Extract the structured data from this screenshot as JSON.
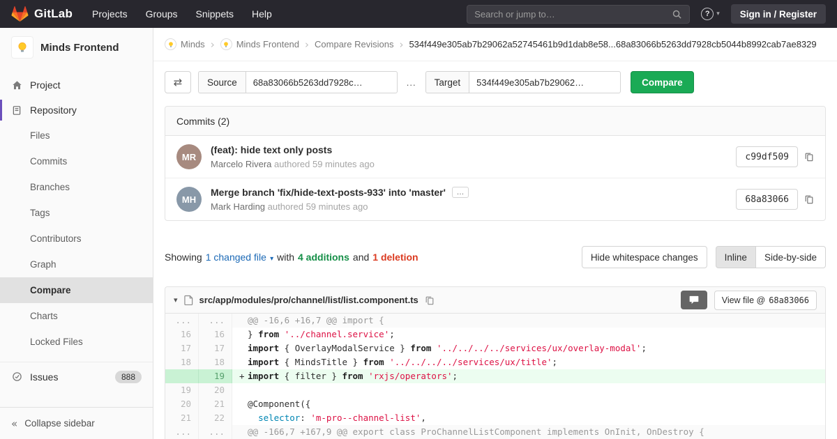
{
  "navbar": {
    "brand": "GitLab",
    "menu": [
      "Projects",
      "Groups",
      "Snippets",
      "Help"
    ],
    "search": {
      "placeholder": "Search or jump to…"
    },
    "help_icon": "?",
    "sign_in_label": "Sign in / Register"
  },
  "sidebar": {
    "project": {
      "name": "Minds Frontend"
    },
    "items": [
      {
        "label": "Project"
      },
      {
        "label": "Repository"
      }
    ],
    "repo_subitems": [
      {
        "label": "Files"
      },
      {
        "label": "Commits"
      },
      {
        "label": "Branches"
      },
      {
        "label": "Tags"
      },
      {
        "label": "Contributors"
      },
      {
        "label": "Graph"
      },
      {
        "label": "Compare",
        "active": true
      },
      {
        "label": "Charts"
      },
      {
        "label": "Locked Files"
      }
    ],
    "issues": {
      "label": "Issues",
      "badge": "888"
    },
    "collapse_label": "Collapse sidebar"
  },
  "breadcrumb": {
    "links": [
      {
        "label": "Minds",
        "avatar": true
      },
      {
        "label": "Minds Frontend",
        "avatar": true
      },
      {
        "label": "Compare Revisions",
        "avatar": false
      }
    ],
    "current": "534f449e305ab7b29062a52745461b9d1dab8e58...68a83066b5263dd7928cb5044b8992cab7ae8329"
  },
  "compare_form": {
    "source_label": "Source",
    "source_value": "68a83066b5263dd7928c…",
    "separator": "...",
    "target_label": "Target",
    "target_value": "534f449e305ab7b29062…",
    "compare_button": "Compare",
    "compare_color": "#1aaa55"
  },
  "commits": {
    "title": "Commits (2)",
    "items": [
      {
        "title": "(feat): hide text only posts",
        "author": "Marcelo Rivera",
        "meta": "authored 59 minutes ago",
        "sha": "c99df509",
        "avatar_initials": "MR",
        "avatar_color": "#a78a7f",
        "expandable": false,
        "expander": "…"
      },
      {
        "title": "Merge branch 'fix/hide-text-posts-933' into 'master'",
        "author": "Mark Harding",
        "meta": "authored 59 minutes ago",
        "sha": "68a83066",
        "avatar_initials": "MH",
        "avatar_color": "#8898a8",
        "expandable": true,
        "expander": "…"
      }
    ]
  },
  "summary": {
    "showing": "Showing",
    "changed_file": "1 changed file",
    "with_text": "with",
    "additions": "4 additions",
    "and_text": "and",
    "deletions": "1 deletion",
    "additions_color": "#168f48",
    "deletions_color": "#db3b21",
    "hide_whitespace": "Hide whitespace changes",
    "inline": "Inline",
    "side_by_side": "Side-by-side"
  },
  "diff": {
    "file_path": "src/app/modules/pro/channel/list/list.component.ts",
    "view_file_label": "View file @",
    "view_file_sha": "68a83066",
    "lines": [
      {
        "type": "hunk",
        "old": "...",
        "new": "...",
        "marker": "",
        "segments": [
          {
            "text": "@@ -16,6 +16,7 @@ import {",
            "cls": "hunk"
          }
        ]
      },
      {
        "type": "context",
        "old": "16",
        "new": "16",
        "marker": "",
        "segments": [
          {
            "text": "} ",
            "cls": "p"
          },
          {
            "text": "from",
            "cls": "k"
          },
          {
            "text": " ",
            "cls": "p"
          },
          {
            "text": "'../channel.service'",
            "cls": "s"
          },
          {
            "text": ";",
            "cls": "p"
          }
        ]
      },
      {
        "type": "context",
        "old": "17",
        "new": "17",
        "marker": "",
        "segments": [
          {
            "text": "import",
            "cls": "k"
          },
          {
            "text": " { OverlayModalService } ",
            "cls": "p"
          },
          {
            "text": "from",
            "cls": "k"
          },
          {
            "text": " ",
            "cls": "p"
          },
          {
            "text": "'../../../../services/ux/overlay-modal'",
            "cls": "s"
          },
          {
            "text": ";",
            "cls": "p"
          }
        ]
      },
      {
        "type": "context",
        "old": "18",
        "new": "18",
        "marker": "",
        "segments": [
          {
            "text": "import",
            "cls": "k"
          },
          {
            "text": " { MindsTitle } ",
            "cls": "p"
          },
          {
            "text": "from",
            "cls": "k"
          },
          {
            "text": " ",
            "cls": "p"
          },
          {
            "text": "'../../../../services/ux/title'",
            "cls": "s"
          },
          {
            "text": ";",
            "cls": "p"
          }
        ]
      },
      {
        "type": "add",
        "old": "",
        "new": "19",
        "marker": "+",
        "segments": [
          {
            "text": "import",
            "cls": "k"
          },
          {
            "text": " { filter } ",
            "cls": "p"
          },
          {
            "text": "from",
            "cls": "k"
          },
          {
            "text": " ",
            "cls": "p"
          },
          {
            "text": "'rxjs/operators'",
            "cls": "s"
          },
          {
            "text": ";",
            "cls": "p"
          }
        ]
      },
      {
        "type": "context",
        "old": "19",
        "new": "20",
        "marker": "",
        "segments": []
      },
      {
        "type": "context",
        "old": "20",
        "new": "21",
        "marker": "",
        "segments": [
          {
            "text": "@Component({",
            "cls": "p"
          }
        ]
      },
      {
        "type": "context",
        "old": "21",
        "new": "22",
        "marker": "",
        "segments": [
          {
            "text": "  ",
            "cls": "p"
          },
          {
            "text": "selector",
            "cls": "attr"
          },
          {
            "text": ": ",
            "cls": "p"
          },
          {
            "text": "'m-pro--channel-list'",
            "cls": "s"
          },
          {
            "text": ",",
            "cls": "p"
          }
        ]
      },
      {
        "type": "hunk",
        "old": "...",
        "new": "...",
        "marker": "",
        "segments": [
          {
            "text": "@@ -166,7 +167,9 @@ export class ProChannelListComponent implements OnInit, OnDestroy {",
            "cls": "hunk"
          }
        ]
      }
    ]
  }
}
